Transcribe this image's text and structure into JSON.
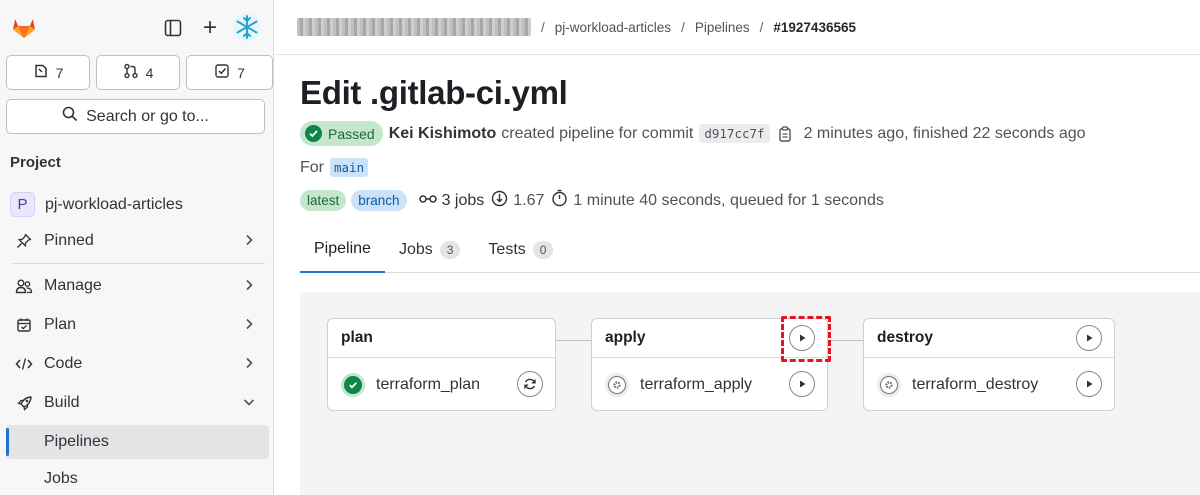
{
  "sidebar": {
    "counters": [
      {
        "icon": "issues-icon",
        "count": "7"
      },
      {
        "icon": "merge-request-icon",
        "count": "4"
      },
      {
        "icon": "todo-icon",
        "count": "7"
      }
    ],
    "search_label": "Search or go to...",
    "section_title": "Project",
    "project": {
      "avatar_letter": "P",
      "name": "pj-workload-articles"
    },
    "nav": {
      "pinned": "Pinned",
      "manage": "Manage",
      "plan": "Plan",
      "code": "Code",
      "build": "Build",
      "pipelines": "Pipelines",
      "jobs": "Jobs"
    }
  },
  "breadcrumb": {
    "items": [
      "pj-workload-articles",
      "Pipelines",
      "#1927436565"
    ],
    "separator": "/"
  },
  "pipeline": {
    "title": "Edit .gitlab-ci.yml",
    "status": "Passed",
    "author": "Kei Kishimoto",
    "created_text": "created pipeline for commit",
    "commit_sha": "d917cc7f",
    "time_text": "2 minutes ago, finished 22 seconds ago",
    "for_label": "For",
    "ref": "main",
    "badges": [
      "latest",
      "branch"
    ],
    "jobs_count": "3 jobs",
    "compute": "1.67",
    "duration": "1 minute 40 seconds, queued for 1 seconds"
  },
  "tabs": [
    {
      "label": "Pipeline",
      "count": ""
    },
    {
      "label": "Jobs",
      "count": "3"
    },
    {
      "label": "Tests",
      "count": "0"
    }
  ],
  "stages": [
    {
      "name": "plan",
      "job": "terraform_plan",
      "job_status": "passed",
      "job_action": "retry"
    },
    {
      "name": "apply",
      "job": "terraform_apply",
      "job_status": "manual",
      "job_action": "play"
    },
    {
      "name": "destroy",
      "job": "terraform_destroy",
      "job_status": "manual",
      "job_action": "play"
    }
  ],
  "colors": {
    "accent": "#1f75cb",
    "success": "#108548",
    "highlight": "#e8141c"
  }
}
